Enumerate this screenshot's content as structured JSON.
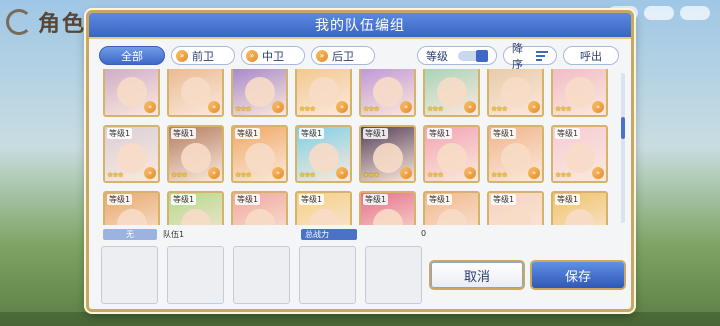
{
  "background": {
    "title": "角色一览"
  },
  "dialog": {
    "title": "我的队伍编组"
  },
  "filters": {
    "all": "全部",
    "roles": [
      {
        "label": "前卫"
      },
      {
        "label": "中卫"
      },
      {
        "label": "后卫"
      }
    ]
  },
  "controls": {
    "level_label": "等级",
    "sort_label": "降序",
    "exit_label": "呼出"
  },
  "roster": {
    "cards": [
      {
        "level": "",
        "stars": "",
        "bg": "#c9a6c7"
      },
      {
        "level": "",
        "stars": "",
        "bg": "#e9b58a"
      },
      {
        "level": "",
        "stars": "★★★",
        "bg": "#9f7ec9"
      },
      {
        "level": "",
        "stars": "★★★",
        "bg": "#f2c486"
      },
      {
        "level": "",
        "stars": "★★★",
        "bg": "#b88fd6"
      },
      {
        "level": "",
        "stars": "★★★",
        "bg": "#9fd1b6"
      },
      {
        "level": "",
        "stars": "★★★",
        "bg": "#e6c7a3"
      },
      {
        "level": "",
        "stars": "★★★",
        "bg": "#f0b7c4"
      },
      {
        "level": "等级1",
        "stars": "★★★",
        "bg": "#d9cfd9"
      },
      {
        "level": "等级1",
        "stars": "★★★",
        "bg": "#b47e62"
      },
      {
        "level": "等级1",
        "stars": "★★★",
        "bg": "#f0a864"
      },
      {
        "level": "等级1",
        "stars": "★★★",
        "bg": "#7fcfe6"
      },
      {
        "level": "等级1",
        "stars": "★★★",
        "bg": "#55405a"
      },
      {
        "level": "等级1",
        "stars": "★★★",
        "bg": "#f2a3b4"
      },
      {
        "level": "等级1",
        "stars": "★★★",
        "bg": "#f0b48c"
      },
      {
        "level": "等级1",
        "stars": "★★★",
        "bg": "#f6cbd6"
      },
      {
        "level": "等级1",
        "stars": "",
        "bg": "#e8a86e"
      },
      {
        "level": "等级1",
        "stars": "",
        "bg": "#b5d88a"
      },
      {
        "level": "等级1",
        "stars": "",
        "bg": "#f0a8a0"
      },
      {
        "level": "等级1",
        "stars": "",
        "bg": "#f5d088"
      },
      {
        "level": "等级1",
        "stars": "",
        "bg": "#e6708a"
      },
      {
        "level": "等级1",
        "stars": "",
        "bg": "#f2b88e"
      },
      {
        "level": "等级1",
        "stars": "",
        "bg": "#f6d2bf"
      },
      {
        "level": "等级1",
        "stars": "",
        "bg": "#f0c46c"
      }
    ]
  },
  "team": {
    "none_tag": "无",
    "name": "队伍1",
    "power_label": "总战力",
    "power_value": "0"
  },
  "buttons": {
    "cancel": "取消",
    "save": "保存"
  }
}
